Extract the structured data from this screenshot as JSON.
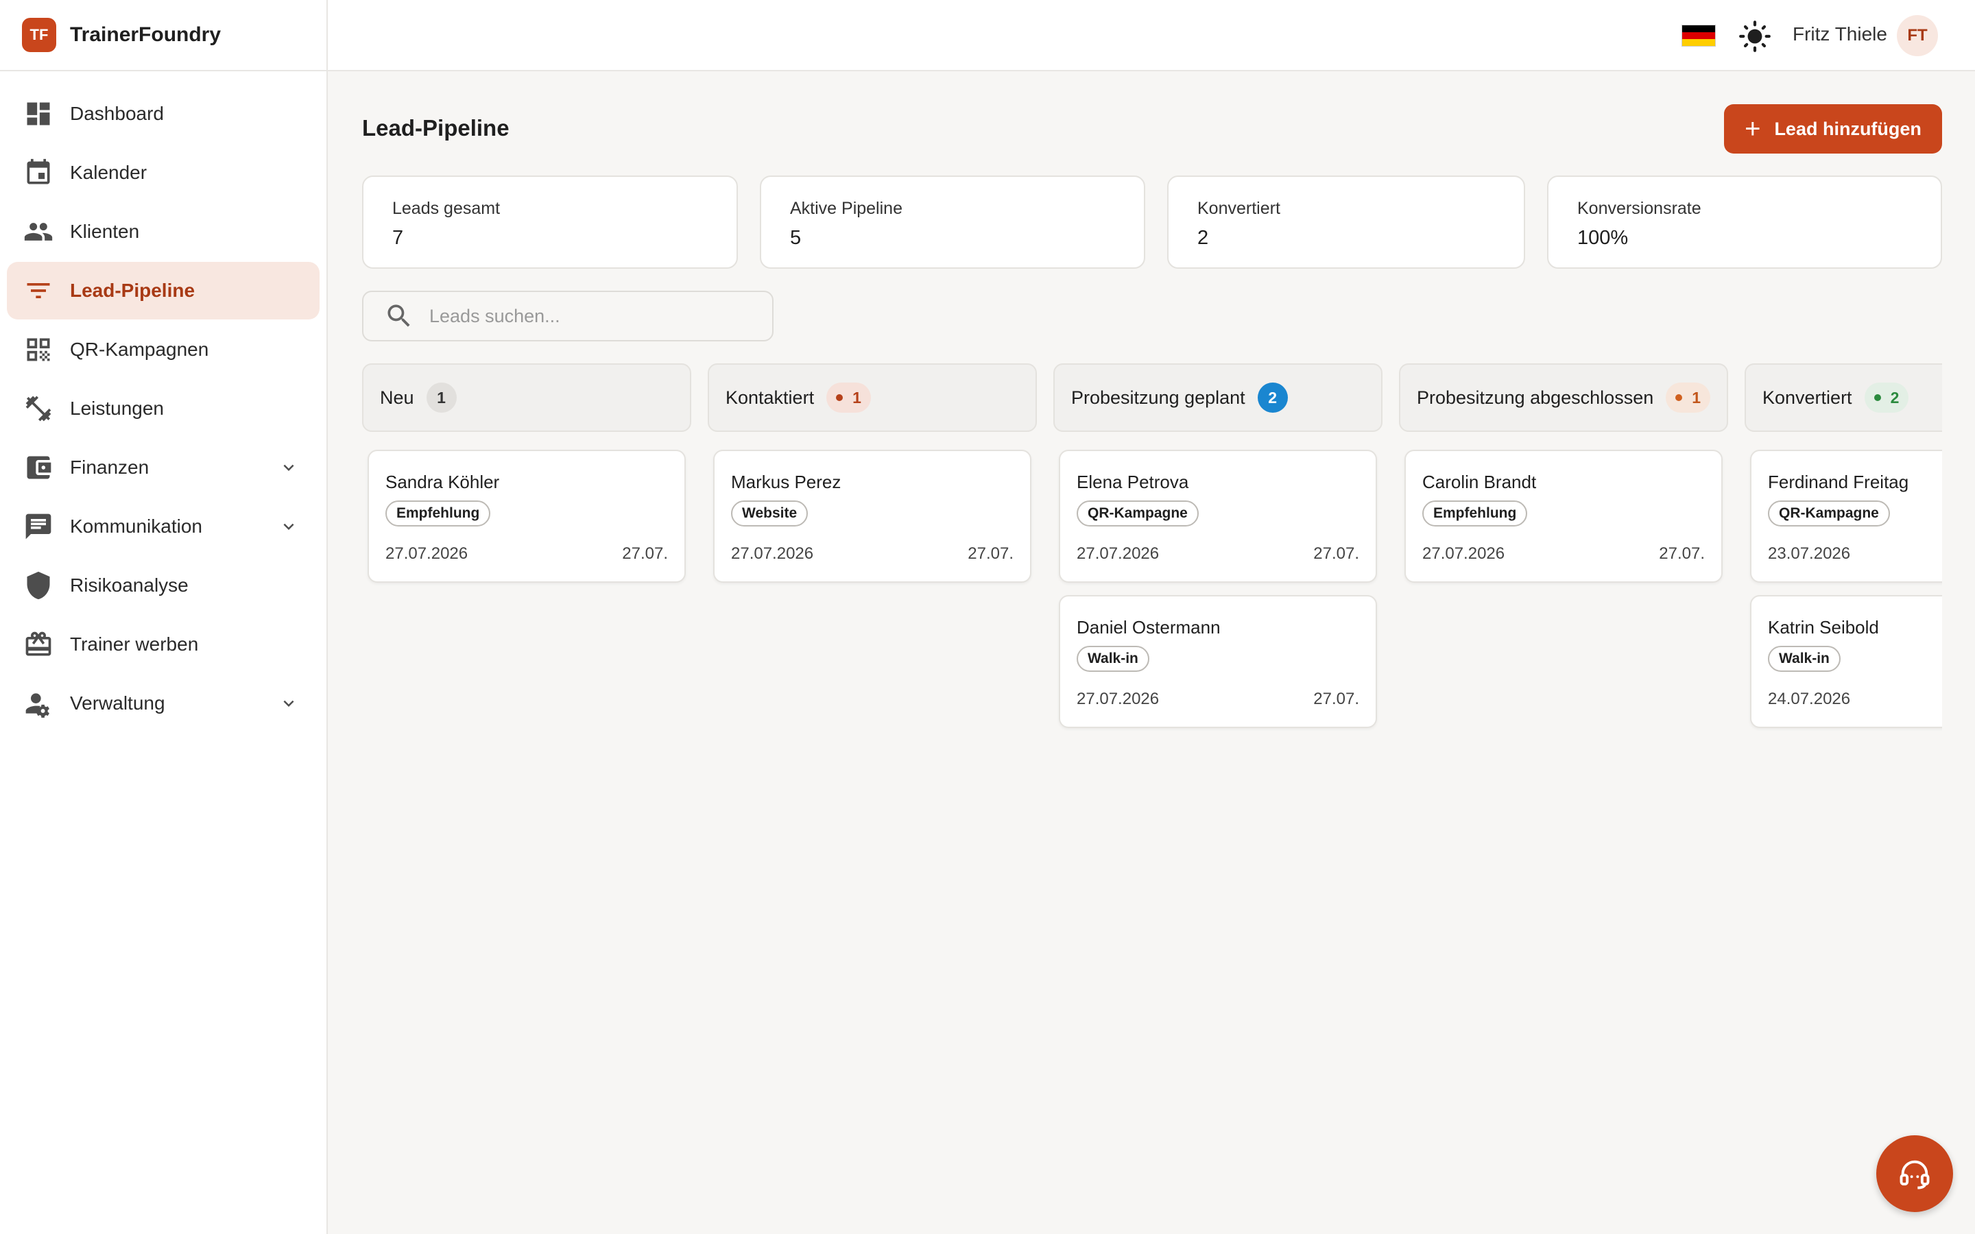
{
  "brand": {
    "logo": "TF",
    "name": "TrainerFoundry"
  },
  "header": {
    "user_name": "Fritz Thiele",
    "avatar_initials": "FT",
    "language": "de-flag",
    "theme_icon": "sun-icon"
  },
  "sidebar": {
    "items": [
      {
        "label": "Dashboard",
        "icon": "dashboard-icon"
      },
      {
        "label": "Kalender",
        "icon": "calendar-icon"
      },
      {
        "label": "Klienten",
        "icon": "people-icon"
      },
      {
        "label": "Lead-Pipeline",
        "icon": "filter-icon",
        "active": true
      },
      {
        "label": "QR-Kampagnen",
        "icon": "qr-code-icon"
      },
      {
        "label": "Leistungen",
        "icon": "dumbbell-icon"
      },
      {
        "label": "Finanzen",
        "icon": "wallet-icon",
        "expandable": true
      },
      {
        "label": "Kommunikation",
        "icon": "chat-icon",
        "expandable": true
      },
      {
        "label": "Risikoanalyse",
        "icon": "shield-icon"
      },
      {
        "label": "Trainer werben",
        "icon": "gift-icon"
      },
      {
        "label": "Verwaltung",
        "icon": "user-settings-icon",
        "expandable": true
      }
    ]
  },
  "main": {
    "title": "Lead-Pipeline",
    "add_button": "Lead hinzufügen",
    "stats": [
      {
        "label": "Leads gesamt",
        "value": "7"
      },
      {
        "label": "Aktive Pipeline",
        "value": "5"
      },
      {
        "label": "Konvertiert",
        "value": "2"
      },
      {
        "label": "Konversionsrate",
        "value": "100%"
      }
    ],
    "search": {
      "placeholder": "Leads suchen..."
    },
    "columns": [
      {
        "title": "Neu",
        "count": "1",
        "cards": [
          {
            "name": "Sandra Köhler",
            "source": "Empfehlung",
            "date": "27.07.2026",
            "date_short": "27.07."
          }
        ]
      },
      {
        "title": "Kontaktiert",
        "count": "1",
        "cards": [
          {
            "name": "Markus Perez",
            "source": "Website",
            "date": "27.07.2026",
            "date_short": "27.07."
          }
        ]
      },
      {
        "title": "Probesitzung geplant",
        "count": "2",
        "cards": [
          {
            "name": "Elena Petrova",
            "source": "QR-Kampagne",
            "date": "27.07.2026",
            "date_short": "27.07."
          },
          {
            "name": "Daniel Ostermann",
            "source": "Walk-in",
            "date": "27.07.2026",
            "date_short": "27.07."
          }
        ]
      },
      {
        "title": "Probesitzung abgeschlossen",
        "count": "1",
        "cards": [
          {
            "name": "Carolin Brandt",
            "source": "Empfehlung",
            "date": "27.07.2026",
            "date_short": "27.07."
          }
        ]
      },
      {
        "title": "Konvertiert",
        "count": "2",
        "cards": [
          {
            "name": "Ferdinand Freitag",
            "source": "QR-Kampagne",
            "date": "23.07.2026",
            "date_short": ""
          },
          {
            "name": "Katrin Seibold",
            "source": "Walk-in",
            "date": "24.07.2026",
            "date_short": ""
          }
        ]
      }
    ]
  },
  "colors": {
    "accent": "#c9461c",
    "active_bg": "#f8e7e0",
    "info": "#1a86d0",
    "success": "#2b8a3e"
  },
  "fab": {
    "icon": "support-headset-icon"
  }
}
